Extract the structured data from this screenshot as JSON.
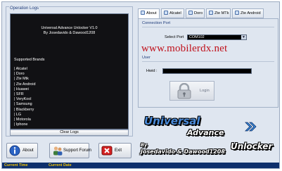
{
  "logs": {
    "title": "Operation Logs",
    "header_line1": "Universal Advance Unlocker V1.0",
    "header_line2": "By Josedavido & Dawood1208",
    "brands_title": "Supported Brands",
    "brands": [
      "| Alcatel",
      "| Doro",
      "| Zte Mtk",
      "| Zte Android",
      "| Huawei",
      "| SFR",
      "| VeryKool",
      "| Samsung",
      "| Blackberry",
      "| LG",
      "| Motorola",
      "| Iphone"
    ],
    "clear_label": "Clear Logs"
  },
  "buttons": {
    "about": "About",
    "support": "Support Forum",
    "exit": "Exit"
  },
  "tabs": [
    "About",
    "Alcatel",
    "Doro",
    "Zte MTk",
    "Zte Android"
  ],
  "connection": {
    "group_label": "Connection Port",
    "select_label": "Select Port",
    "port_value": "COM102"
  },
  "user": {
    "group_label": "User",
    "hwid_label": "Hwid :",
    "login_label": "Login"
  },
  "watermark": "www.mobilerdx.net",
  "logo": {
    "word1": "Universal",
    "word2": "Advance",
    "word3": "Unlocker",
    "by": "By",
    "authors": "Josedavido & Dawood1208"
  },
  "status": {
    "time_label": "Current Time",
    "date_label": "Current Date"
  },
  "icons": {
    "about": "info-icon",
    "support": "people-icon",
    "exit": "exit-icon",
    "login": "padlock-icon",
    "logo_arrow": "double-chevron-right-icon"
  },
  "colors": {
    "accent_blue": "#4a8ad8",
    "watermark_red": "#c0101a",
    "status_bar": "#0e2f6c",
    "status_text": "#f2c300"
  }
}
